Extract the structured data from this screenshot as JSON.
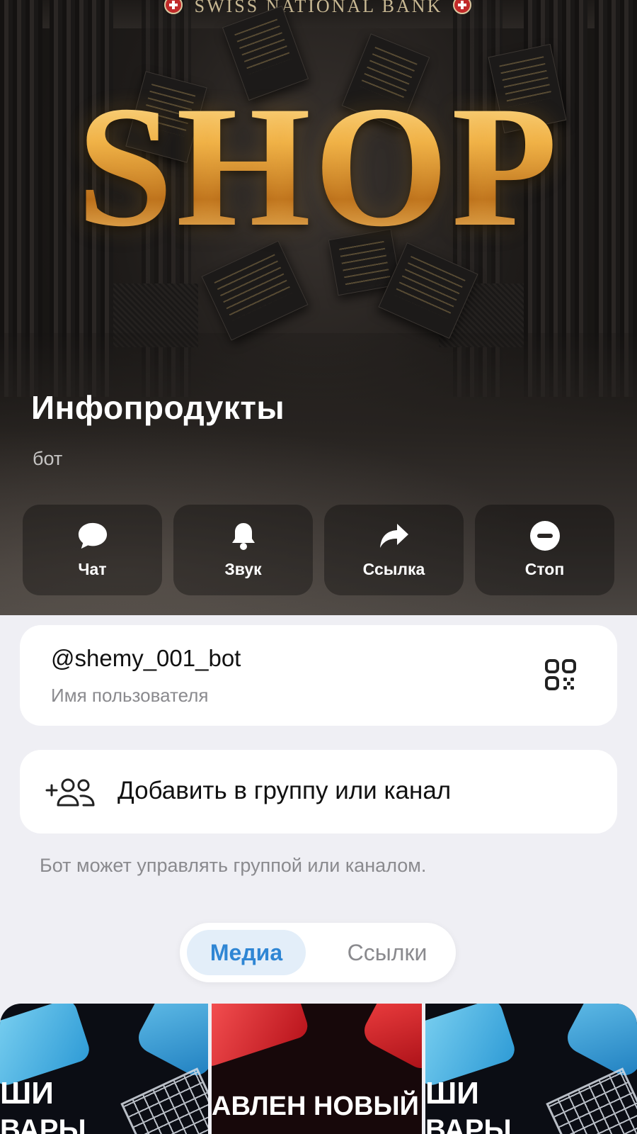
{
  "hero": {
    "bank_sign": "SWISS NATIONAL BANK",
    "banner_word": "SHOP",
    "title": "Инфопродукты",
    "subtitle": "бот"
  },
  "actions": [
    {
      "label": "Чат",
      "icon": "chat-bubble-icon"
    },
    {
      "label": "Звук",
      "icon": "bell-icon"
    },
    {
      "label": "Ссылка",
      "icon": "share-arrow-icon"
    },
    {
      "label": "Стоп",
      "icon": "stop-circle-icon"
    }
  ],
  "username": {
    "value": "@shemy_001_bot",
    "label": "Имя пользователя",
    "qr_icon": "qr-code-icon"
  },
  "add_to_group": {
    "label": "Добавить в группу или канал",
    "icon": "add-users-icon",
    "hint": "Бот может управлять группой или каналом."
  },
  "tabs": {
    "media": "Медиа",
    "links": "Ссылки",
    "active": "media"
  },
  "media_tiles": [
    {
      "line1": "ШИ",
      "line2": "ВАРЫ"
    },
    {
      "line1": "АВЛЕН НОВЫЙ ТО"
    },
    {
      "line1": "ШИ",
      "line2": "ВАРЫ"
    }
  ],
  "colors": {
    "accent": "#2f86d4",
    "gold": "#f1b44a",
    "background": "#efeff4"
  }
}
